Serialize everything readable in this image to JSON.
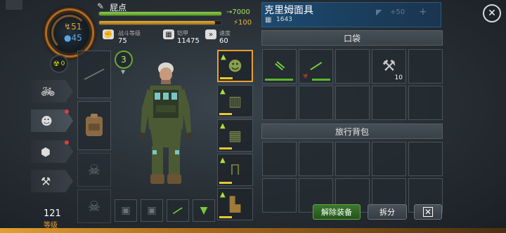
{
  "player": {
    "name": "屁点",
    "hunger": "51",
    "water": "45",
    "radiation": "0",
    "xp_value": "7000",
    "xp_fill": 1.0,
    "energy_value": "100",
    "energy_fill": 0.95,
    "level": "121",
    "level_label": "等级"
  },
  "stats": [
    {
      "icon": "fist-icon",
      "label": "战斗等级",
      "value": "75"
    },
    {
      "icon": "armor-icon",
      "label": "铠甲",
      "value": "11475"
    },
    {
      "icon": "speed-icon",
      "label": "速度",
      "value": "60"
    }
  ],
  "character": {
    "level_badge": "3"
  },
  "side_menu": [
    {
      "icon": "motorcycle-icon",
      "has_notice": false
    },
    {
      "icon": "mask-icon",
      "has_notice": true
    },
    {
      "icon": "crate-icon",
      "has_notice": true
    },
    {
      "icon": "craft-icon",
      "has_notice": false
    }
  ],
  "selected_item": {
    "name": "克里姆面具",
    "weight": "1643",
    "dim_value": "+50"
  },
  "sections": {
    "pocket": "口袋",
    "backpack": "旅行背包"
  },
  "pocket_items": [
    {
      "name": "green-rifle-icon",
      "count": ""
    },
    {
      "name": "biohazard-blade-icon",
      "count": ""
    },
    {
      "name": "empty",
      "count": ""
    },
    {
      "name": "hatchet-icon",
      "count": "10"
    },
    {
      "name": "empty",
      "count": ""
    }
  ],
  "buttons": {
    "unequip": "解除装备",
    "split": "拆分"
  },
  "colors": {
    "accent": "#e8a030",
    "xp": "#8ad04a",
    "header": "#1c4a70",
    "notice": "#e23b3b"
  }
}
